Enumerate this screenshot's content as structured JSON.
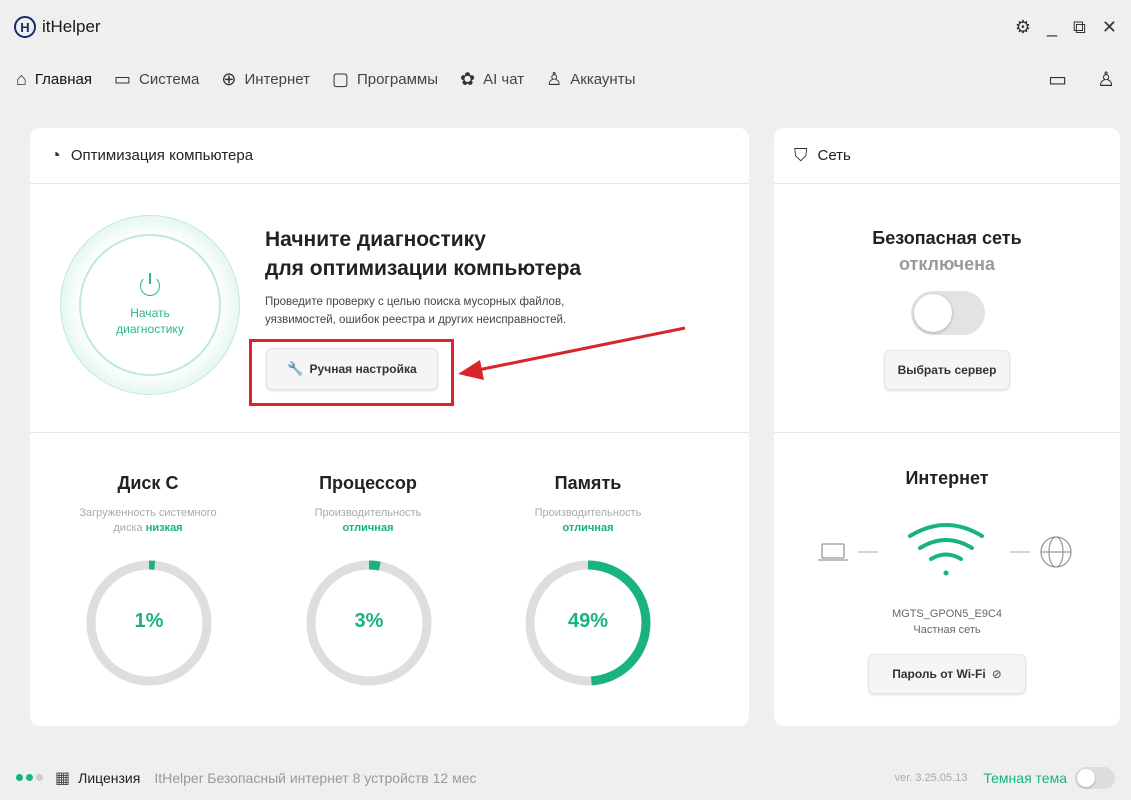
{
  "app": {
    "title": "itHelper",
    "logo_letter": "H"
  },
  "window": {
    "settings_icon": "gear-icon",
    "minimize_icon": "minimize-icon",
    "popout_icon": "external-window-icon",
    "close_icon": "close-icon"
  },
  "nav": {
    "items": [
      {
        "label": "Главная",
        "icon": "home-icon",
        "active": true
      },
      {
        "label": "Система",
        "icon": "laptop-icon"
      },
      {
        "label": "Интернет",
        "icon": "globe-icon"
      },
      {
        "label": "Программы",
        "icon": "folder-icon"
      },
      {
        "label": "AI чат",
        "icon": "openai-icon"
      },
      {
        "label": "Аккаунты",
        "icon": "add-user-icon"
      }
    ],
    "chat_icon": "chat-icon",
    "profile_icon": "user-icon"
  },
  "optimization": {
    "header": "Оптимизация компьютера",
    "header_icon": "speedometer-icon",
    "start_label_1": "Начать",
    "start_label_2": "диагностику",
    "title_line1": "Начните диагностику",
    "title_line2": "для оптимизации компьютера",
    "desc_line1": "Проведите проверку с целью поиска мусорных файлов,",
    "desc_line2": "уязвимостей, ошибок реестра и других неисправностей.",
    "manual_button": "Ручная настройка",
    "manual_icon": "wrench-icon"
  },
  "stats": [
    {
      "title": "Диск C",
      "sub1": "Загруженность системного",
      "sub2_prefix": "диска ",
      "sub2_status": "низкая",
      "value": "1%",
      "percent": 1
    },
    {
      "title": "Процессор",
      "sub1": "Производительность",
      "sub2_prefix": "",
      "sub2_status": "отличная",
      "value": "3%",
      "percent": 3
    },
    {
      "title": "Память",
      "sub1": "Производительность",
      "sub2_prefix": "",
      "sub2_status": "отличная",
      "value": "49%",
      "percent": 49
    }
  ],
  "network": {
    "header": "Сеть",
    "header_icon": "shield-icon",
    "secure_title": "Безопасная сеть",
    "secure_status": "отключена",
    "secure_enabled": false,
    "server_button": "Выбрать сервер",
    "internet_title": "Интернет",
    "ssid": "MGTS_GPON5_E9C4",
    "network_type": "Частная сеть",
    "wifi_button": "Пароль от Wi-Fi",
    "wifi_button_icon": "eye-slash-icon"
  },
  "status": {
    "license_label": "Лицензия",
    "license_text": "ItHelper Безопасный интернет 8 устройств 12 мес",
    "version": "ver. 3.25.05.13",
    "theme_label": "Темная тема",
    "dark_theme_enabled": false
  },
  "colors": {
    "accent": "#19b37d",
    "highlight": "#d9242a",
    "track": "#dedede"
  }
}
